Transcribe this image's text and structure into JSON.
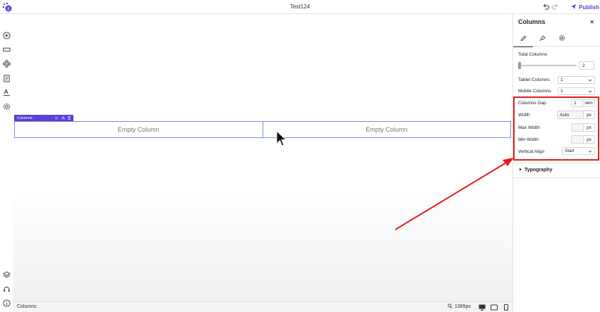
{
  "app": {
    "title": "Test124",
    "publish_label": "Publish"
  },
  "canvas": {
    "block_label": "Columns",
    "columns": [
      {
        "label": "Empty Column"
      },
      {
        "label": "Empty Column"
      }
    ]
  },
  "bottombar": {
    "breadcrumb": "Columns",
    "zoom": "1389px"
  },
  "panel": {
    "title": "Columns",
    "close": "×",
    "total_columns_label": "Total Columns",
    "total_columns_value": "2",
    "total_columns_slider_fraction": 0.0,
    "tablet_columns_label": "Tablet Columns",
    "tablet_columns_value": "1",
    "mobile_columns_label": "Mobile Columns",
    "mobile_columns_value": "1",
    "columns_gap_label": "Columns Gap",
    "columns_gap_value": "1",
    "columns_gap_unit": "rem",
    "width_label": "Width",
    "width_value": "Auto",
    "width_unit": "px",
    "max_width_label": "Max Width",
    "max_width_unit": "px",
    "min_width_label": "Min Width",
    "min_width_unit": "px",
    "vertical_align_label": "Vertical Align",
    "vertical_align_value": "Start",
    "typography_label": "Typography"
  },
  "icons": {
    "logo": "logo-icon",
    "undo": "undo-icon",
    "redo": "redo-icon",
    "publish": "send-icon",
    "left_toolbar": [
      "add-icon",
      "layout-icon",
      "components-icon",
      "pages-icon",
      "typography-icon",
      "settings-icon",
      "layers-icon",
      "help-icon",
      "info-icon"
    ]
  },
  "colors": {
    "accent": "#5b3fd6",
    "highlight": "#e01e1e",
    "column_border": "#7b8fd9"
  }
}
